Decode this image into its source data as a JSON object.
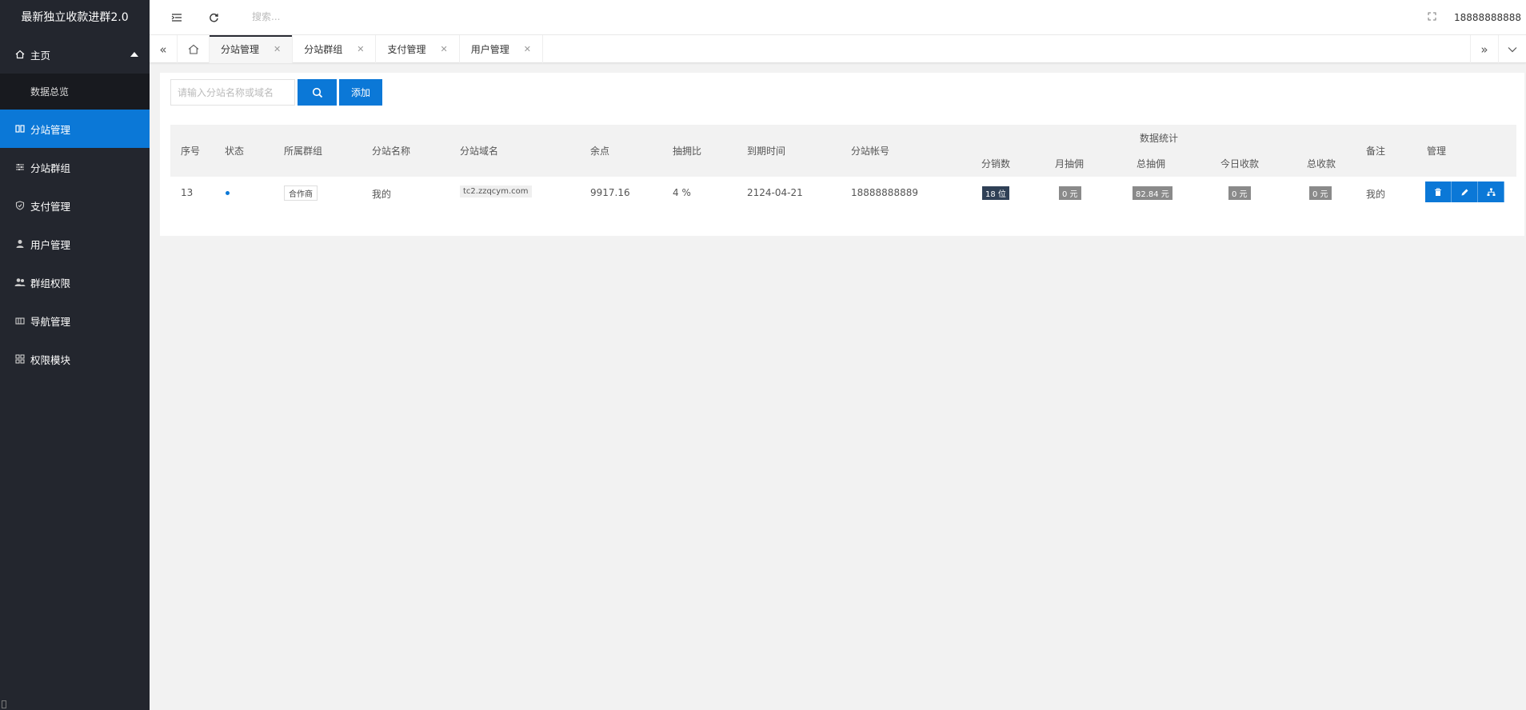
{
  "app": {
    "title": "最新独立收款进群2.0"
  },
  "sidebar": {
    "items": [
      {
        "label": "主页",
        "icon": "home-icon"
      },
      {
        "label": "数据总览",
        "icon": ""
      },
      {
        "label": "分站管理",
        "icon": "columns-icon"
      },
      {
        "label": "分站群组",
        "icon": "sliders-icon"
      },
      {
        "label": "支付管理",
        "icon": "shield-icon"
      },
      {
        "label": "用户管理",
        "icon": "user-icon"
      },
      {
        "label": "群组权限",
        "icon": "users-icon"
      },
      {
        "label": "导航管理",
        "icon": "nav-icon"
      },
      {
        "label": "权限模块",
        "icon": "grid-icon"
      }
    ],
    "active": "分站管理",
    "accent": "#0b78d7"
  },
  "header": {
    "search_placeholder": "搜索...",
    "username": "18888888888"
  },
  "tabs": [
    {
      "label": "分站管理",
      "active": true
    },
    {
      "label": "分站群组",
      "active": false
    },
    {
      "label": "支付管理",
      "active": false
    },
    {
      "label": "用户管理",
      "active": false
    }
  ],
  "toolbar": {
    "search_placeholder": "请输入分站名称或域名",
    "add_label": "添加"
  },
  "table": {
    "group_header": "数据统计",
    "headers": {
      "id": "序号",
      "status": "状态",
      "group": "所属群组",
      "name": "分站名称",
      "domain": "分站域名",
      "balance": "余点",
      "ratio": "抽拥比",
      "expire": "到期时间",
      "account": "分站帐号",
      "sales": "分销数",
      "month_commission": "月抽佣",
      "total_commission": "总抽佣",
      "today_income": "今日收款",
      "total_income": "总收款",
      "note": "备注",
      "manage": "管理"
    },
    "rows": [
      {
        "id": "13",
        "group": "合作商",
        "name": "我的",
        "domain": "tc2.zzqcym.com",
        "balance": "9917.16",
        "ratio": "4 %",
        "expire": "2124-04-21",
        "account": "18888888889",
        "sales": "18 位",
        "month_commission": "0 元",
        "total_commission": "82.84 元",
        "today_income": "0 元",
        "total_income": "0 元",
        "note": "我的"
      }
    ]
  }
}
